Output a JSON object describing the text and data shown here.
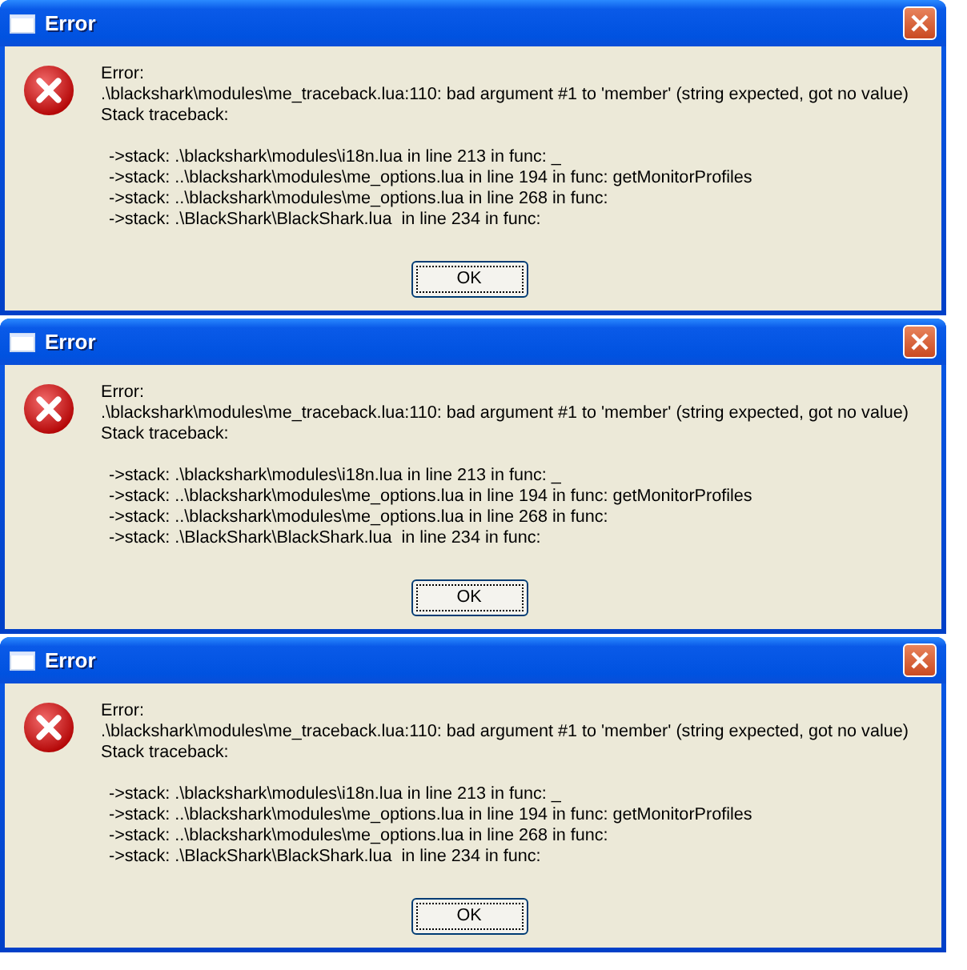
{
  "dialogs": [
    {
      "title": "Error",
      "message": [
        "Error:",
        ".\\blackshark\\modules\\me_traceback.lua:110: bad argument #1 to 'member' (string expected, got no value)",
        "Stack traceback:"
      ],
      "stack": [
        "->stack: .\\blackshark\\modules\\i18n.lua in line 213 in func: _",
        "->stack: ..\\blackshark\\modules\\me_options.lua in line 194 in func: getMonitorProfiles",
        "->stack: ..\\blackshark\\modules\\me_options.lua in line 268 in func:",
        "->stack: .\\BlackShark\\BlackShark.lua  in line 234 in func:"
      ],
      "button": "OK"
    },
    {
      "title": "Error",
      "message": [
        "Error:",
        ".\\blackshark\\modules\\me_traceback.lua:110: bad argument #1 to 'member' (string expected, got no value)",
        "Stack traceback:"
      ],
      "stack": [
        "->stack: .\\blackshark\\modules\\i18n.lua in line 213 in func: _",
        "->stack: ..\\blackshark\\modules\\me_options.lua in line 194 in func: getMonitorProfiles",
        "->stack: ..\\blackshark\\modules\\me_options.lua in line 268 in func:",
        "->stack: .\\BlackShark\\BlackShark.lua  in line 234 in func:"
      ],
      "button": "OK"
    },
    {
      "title": "Error",
      "message": [
        "Error:",
        ".\\blackshark\\modules\\me_traceback.lua:110: bad argument #1 to 'member' (string expected, got no value)",
        "Stack traceback:"
      ],
      "stack": [
        "->stack: .\\blackshark\\modules\\i18n.lua in line 213 in func: _",
        "->stack: ..\\blackshark\\modules\\me_options.lua in line 194 in func: getMonitorProfiles",
        "->stack: ..\\blackshark\\modules\\me_options.lua in line 268 in func:",
        "->stack: .\\BlackShark\\BlackShark.lua  in line 234 in func:"
      ],
      "button": "OK"
    }
  ]
}
